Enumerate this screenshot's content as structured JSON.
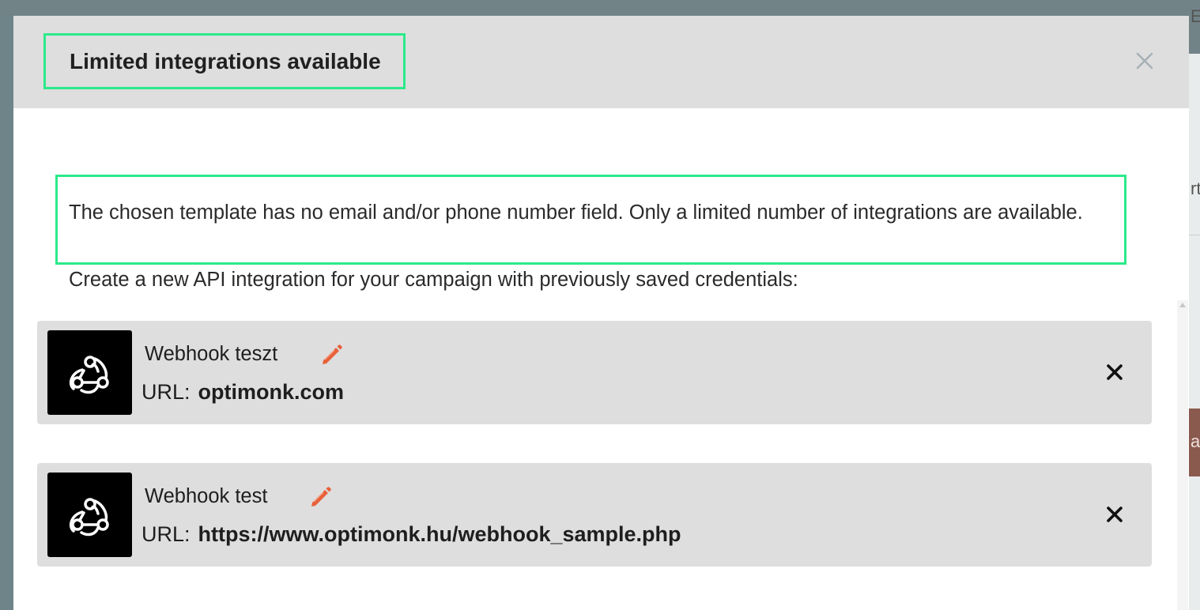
{
  "background": {
    "right_edge_text_1": "E",
    "right_edge_text_2": "rt",
    "right_edge_text_3": "a"
  },
  "modal": {
    "title": "Limited integrations available",
    "close_icon": "close-icon",
    "notice": "The chosen template has no email and/or phone number field. Only a limited number of integrations are available.",
    "instruction": "Create a new API integration for your campaign with previously saved credentials:",
    "integrations": [
      {
        "name": "Webhook teszt",
        "url_label": "URL:",
        "url": "optimonk.com",
        "icon": "webhook-icon"
      },
      {
        "name": "Webhook test",
        "url_label": "URL:",
        "url": "https://www.optimonk.hu/webhook_sample.php",
        "icon": "webhook-icon"
      }
    ]
  },
  "colors": {
    "highlight_border": "#2bea8a",
    "edit_icon": "#e8613a",
    "header_bg": "#dedede",
    "card_bg": "#dedede"
  }
}
